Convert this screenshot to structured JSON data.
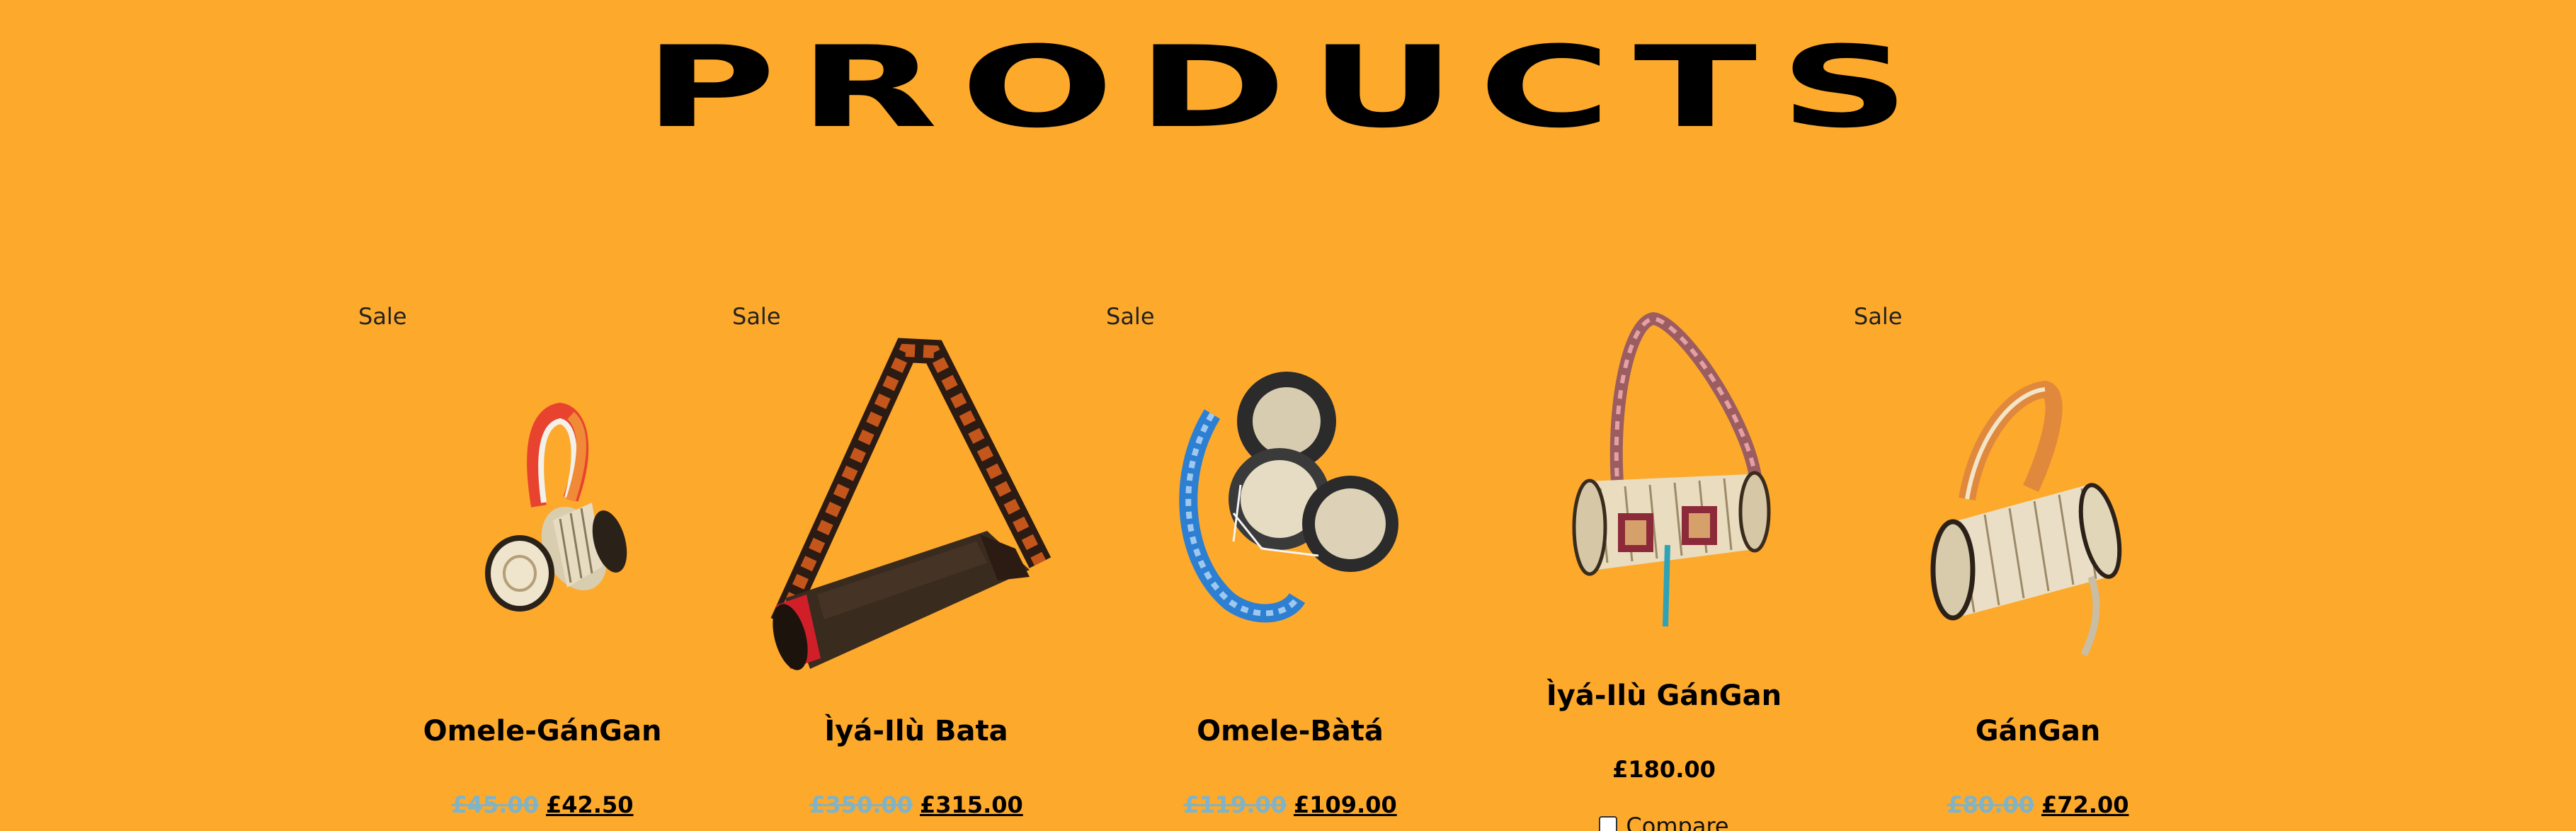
{
  "page": {
    "title": "PRODUCTS"
  },
  "colors": {
    "background": "#FDA92C",
    "text": "#000000",
    "old_price": "#7FB3C8"
  },
  "products": [
    {
      "badge": "Sale",
      "name": "Omele-GánGan",
      "old_price": "£45.00",
      "price": "£42.50",
      "image": "small-talking-drum-image"
    },
    {
      "badge": "Sale",
      "name": "Ìyá-Ilù Bata",
      "old_price": "£350.00",
      "price": "£315.00",
      "image": "large-bata-drum-image"
    },
    {
      "badge": "Sale",
      "name": "Omele-Bàtá",
      "old_price": "£119.00",
      "price": "£109.00",
      "image": "twin-bata-drums-image"
    },
    {
      "badge": "",
      "name": "Ìyá-Ilù GánGan",
      "old_price": "",
      "price": "£180.00",
      "compare_label": "Compare",
      "image": "large-talking-drum-image"
    },
    {
      "badge": "Sale",
      "name": "GánGan",
      "old_price": "£80.00",
      "price": "£72.00",
      "image": "talking-drum-image"
    }
  ]
}
